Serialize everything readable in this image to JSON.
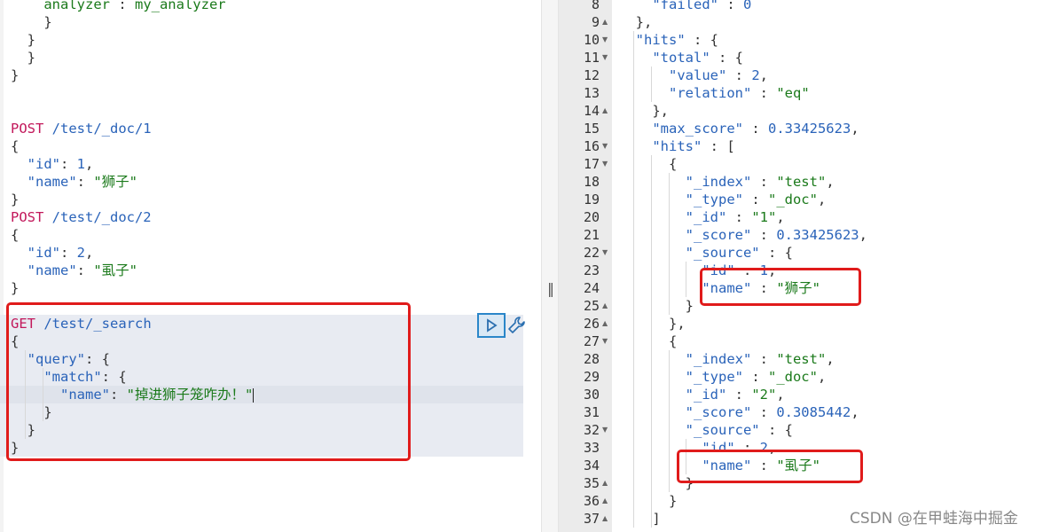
{
  "console": {
    "request_lines": [
      [
        {
          "c": "u",
          "t": "    "
        },
        {
          "c": "s",
          "t": "analyzer"
        },
        {
          "c": "p",
          "t": " : "
        },
        {
          "c": "s",
          "t": "my_analyzer"
        }
      ],
      [
        {
          "c": "p",
          "t": "    }"
        }
      ],
      [
        {
          "c": "p",
          "t": "  }"
        }
      ],
      [
        {
          "c": "p",
          "t": "  }"
        }
      ],
      [
        {
          "c": "p",
          "t": "}"
        }
      ],
      [],
      [],
      [
        {
          "c": "m",
          "t": "POST"
        },
        {
          "c": "k",
          "t": " /test/_doc/1"
        }
      ],
      [
        {
          "c": "p",
          "t": "{"
        }
      ],
      [
        {
          "c": "p",
          "t": "  "
        },
        {
          "c": "k",
          "t": "\"id\""
        },
        {
          "c": "p",
          "t": ": "
        },
        {
          "c": "n",
          "t": "1"
        },
        {
          "c": "p",
          "t": ","
        }
      ],
      [
        {
          "c": "p",
          "t": "  "
        },
        {
          "c": "k",
          "t": "\"name\""
        },
        {
          "c": "p",
          "t": ": "
        },
        {
          "c": "s",
          "t": "\"狮子\""
        }
      ],
      [
        {
          "c": "p",
          "t": "}"
        }
      ],
      [
        {
          "c": "m",
          "t": "POST"
        },
        {
          "c": "k",
          "t": " /test/_doc/2"
        }
      ],
      [
        {
          "c": "p",
          "t": "{"
        }
      ],
      [
        {
          "c": "p",
          "t": "  "
        },
        {
          "c": "k",
          "t": "\"id\""
        },
        {
          "c": "p",
          "t": ": "
        },
        {
          "c": "n",
          "t": "2"
        },
        {
          "c": "p",
          "t": ","
        }
      ],
      [
        {
          "c": "p",
          "t": "  "
        },
        {
          "c": "k",
          "t": "\"name\""
        },
        {
          "c": "p",
          "t": ": "
        },
        {
          "c": "s",
          "t": "\"虱子\""
        }
      ],
      [
        {
          "c": "p",
          "t": "}"
        }
      ],
      [],
      [
        {
          "c": "m",
          "t": "GET"
        },
        {
          "c": "k",
          "t": " /test/_search"
        }
      ],
      [
        {
          "c": "p",
          "t": "{"
        }
      ],
      [
        {
          "c": "p",
          "t": "  "
        },
        {
          "c": "k",
          "t": "\"query\""
        },
        {
          "c": "p",
          "t": ": {"
        }
      ],
      [
        {
          "c": "p",
          "t": "    "
        },
        {
          "c": "k",
          "t": "\"match\""
        },
        {
          "c": "p",
          "t": ": {"
        }
      ],
      [
        {
          "c": "p",
          "t": "      "
        },
        {
          "c": "k",
          "t": "\"name\""
        },
        {
          "c": "p",
          "t": ": "
        },
        {
          "c": "s",
          "t": "\"掉进狮子笼咋办！\""
        }
      ],
      [
        {
          "c": "p",
          "t": "    }"
        }
      ],
      [
        {
          "c": "p",
          "t": "  }"
        }
      ],
      [
        {
          "c": "p",
          "t": "}"
        }
      ]
    ],
    "response_lines": [
      {
        "n": "8",
        "f": "",
        "tokens": [
          {
            "c": "p",
            "t": "    "
          },
          {
            "c": "k",
            "t": "\"failed\""
          },
          {
            "c": "p",
            "t": " : "
          },
          {
            "c": "n",
            "t": "0"
          }
        ]
      },
      {
        "n": "9",
        "f": "▲",
        "tokens": [
          {
            "c": "p",
            "t": "  },"
          }
        ]
      },
      {
        "n": "10",
        "f": "▼",
        "tokens": [
          {
            "c": "p",
            "t": "  "
          },
          {
            "c": "k",
            "t": "\"hits\""
          },
          {
            "c": "p",
            "t": " : {"
          }
        ]
      },
      {
        "n": "11",
        "f": "▼",
        "tokens": [
          {
            "c": "p",
            "t": "    "
          },
          {
            "c": "k",
            "t": "\"total\""
          },
          {
            "c": "p",
            "t": " : {"
          }
        ]
      },
      {
        "n": "12",
        "f": "",
        "tokens": [
          {
            "c": "p",
            "t": "      "
          },
          {
            "c": "k",
            "t": "\"value\""
          },
          {
            "c": "p",
            "t": " : "
          },
          {
            "c": "n",
            "t": "2"
          },
          {
            "c": "p",
            "t": ","
          }
        ]
      },
      {
        "n": "13",
        "f": "",
        "tokens": [
          {
            "c": "p",
            "t": "      "
          },
          {
            "c": "k",
            "t": "\"relation\""
          },
          {
            "c": "p",
            "t": " : "
          },
          {
            "c": "s",
            "t": "\"eq\""
          }
        ]
      },
      {
        "n": "14",
        "f": "▲",
        "tokens": [
          {
            "c": "p",
            "t": "    },"
          }
        ]
      },
      {
        "n": "15",
        "f": "",
        "tokens": [
          {
            "c": "p",
            "t": "    "
          },
          {
            "c": "k",
            "t": "\"max_score\""
          },
          {
            "c": "p",
            "t": " : "
          },
          {
            "c": "n",
            "t": "0.33425623"
          },
          {
            "c": "p",
            "t": ","
          }
        ]
      },
      {
        "n": "16",
        "f": "▼",
        "tokens": [
          {
            "c": "p",
            "t": "    "
          },
          {
            "c": "k",
            "t": "\"hits\""
          },
          {
            "c": "p",
            "t": " : ["
          }
        ]
      },
      {
        "n": "17",
        "f": "▼",
        "tokens": [
          {
            "c": "p",
            "t": "      {"
          }
        ]
      },
      {
        "n": "18",
        "f": "",
        "tokens": [
          {
            "c": "p",
            "t": "        "
          },
          {
            "c": "k",
            "t": "\"_index\""
          },
          {
            "c": "p",
            "t": " : "
          },
          {
            "c": "s",
            "t": "\"test\""
          },
          {
            "c": "p",
            "t": ","
          }
        ]
      },
      {
        "n": "19",
        "f": "",
        "tokens": [
          {
            "c": "p",
            "t": "        "
          },
          {
            "c": "k",
            "t": "\"_type\""
          },
          {
            "c": "p",
            "t": " : "
          },
          {
            "c": "s",
            "t": "\"_doc\""
          },
          {
            "c": "p",
            "t": ","
          }
        ]
      },
      {
        "n": "20",
        "f": "",
        "tokens": [
          {
            "c": "p",
            "t": "        "
          },
          {
            "c": "k",
            "t": "\"_id\""
          },
          {
            "c": "p",
            "t": " : "
          },
          {
            "c": "s",
            "t": "\"1\""
          },
          {
            "c": "p",
            "t": ","
          }
        ]
      },
      {
        "n": "21",
        "f": "",
        "tokens": [
          {
            "c": "p",
            "t": "        "
          },
          {
            "c": "k",
            "t": "\"_score\""
          },
          {
            "c": "p",
            "t": " : "
          },
          {
            "c": "n",
            "t": "0.33425623"
          },
          {
            "c": "p",
            "t": ","
          }
        ]
      },
      {
        "n": "22",
        "f": "▼",
        "tokens": [
          {
            "c": "p",
            "t": "        "
          },
          {
            "c": "k",
            "t": "\"_source\""
          },
          {
            "c": "p",
            "t": " : {"
          }
        ]
      },
      {
        "n": "23",
        "f": "",
        "tokens": [
          {
            "c": "p",
            "t": "          "
          },
          {
            "c": "k",
            "t": "\"id\""
          },
          {
            "c": "p",
            "t": " : "
          },
          {
            "c": "n",
            "t": "1"
          },
          {
            "c": "p",
            "t": ","
          }
        ]
      },
      {
        "n": "24",
        "f": "",
        "tokens": [
          {
            "c": "p",
            "t": "          "
          },
          {
            "c": "k",
            "t": "\"name\""
          },
          {
            "c": "p",
            "t": " : "
          },
          {
            "c": "s",
            "t": "\"狮子\""
          }
        ]
      },
      {
        "n": "25",
        "f": "▲",
        "tokens": [
          {
            "c": "p",
            "t": "        }"
          }
        ]
      },
      {
        "n": "26",
        "f": "▲",
        "tokens": [
          {
            "c": "p",
            "t": "      },"
          }
        ]
      },
      {
        "n": "27",
        "f": "▼",
        "tokens": [
          {
            "c": "p",
            "t": "      {"
          }
        ]
      },
      {
        "n": "28",
        "f": "",
        "tokens": [
          {
            "c": "p",
            "t": "        "
          },
          {
            "c": "k",
            "t": "\"_index\""
          },
          {
            "c": "p",
            "t": " : "
          },
          {
            "c": "s",
            "t": "\"test\""
          },
          {
            "c": "p",
            "t": ","
          }
        ]
      },
      {
        "n": "29",
        "f": "",
        "tokens": [
          {
            "c": "p",
            "t": "        "
          },
          {
            "c": "k",
            "t": "\"_type\""
          },
          {
            "c": "p",
            "t": " : "
          },
          {
            "c": "s",
            "t": "\"_doc\""
          },
          {
            "c": "p",
            "t": ","
          }
        ]
      },
      {
        "n": "30",
        "f": "",
        "tokens": [
          {
            "c": "p",
            "t": "        "
          },
          {
            "c": "k",
            "t": "\"_id\""
          },
          {
            "c": "p",
            "t": " : "
          },
          {
            "c": "s",
            "t": "\"2\""
          },
          {
            "c": "p",
            "t": ","
          }
        ]
      },
      {
        "n": "31",
        "f": "",
        "tokens": [
          {
            "c": "p",
            "t": "        "
          },
          {
            "c": "k",
            "t": "\"_score\""
          },
          {
            "c": "p",
            "t": " : "
          },
          {
            "c": "n",
            "t": "0.3085442"
          },
          {
            "c": "p",
            "t": ","
          }
        ]
      },
      {
        "n": "32",
        "f": "▼",
        "tokens": [
          {
            "c": "p",
            "t": "        "
          },
          {
            "c": "k",
            "t": "\"_source\""
          },
          {
            "c": "p",
            "t": " : {"
          }
        ]
      },
      {
        "n": "33",
        "f": "",
        "tokens": [
          {
            "c": "p",
            "t": "          "
          },
          {
            "c": "k",
            "t": "\"id\""
          },
          {
            "c": "p",
            "t": " : "
          },
          {
            "c": "n",
            "t": "2"
          },
          {
            "c": "p",
            "t": ","
          }
        ]
      },
      {
        "n": "34",
        "f": "",
        "tokens": [
          {
            "c": "p",
            "t": "          "
          },
          {
            "c": "k",
            "t": "\"name\""
          },
          {
            "c": "p",
            "t": " : "
          },
          {
            "c": "s",
            "t": "\"虱子\""
          }
        ]
      },
      {
        "n": "35",
        "f": "▲",
        "tokens": [
          {
            "c": "p",
            "t": "        }"
          }
        ]
      },
      {
        "n": "36",
        "f": "▲",
        "tokens": [
          {
            "c": "p",
            "t": "      }"
          }
        ]
      },
      {
        "n": "37",
        "f": "▲",
        "tokens": [
          {
            "c": "p",
            "t": "    ]"
          }
        ]
      }
    ],
    "divider_glyph": "‖",
    "watermark": "CSDN @在甲蛙海中掘金"
  }
}
